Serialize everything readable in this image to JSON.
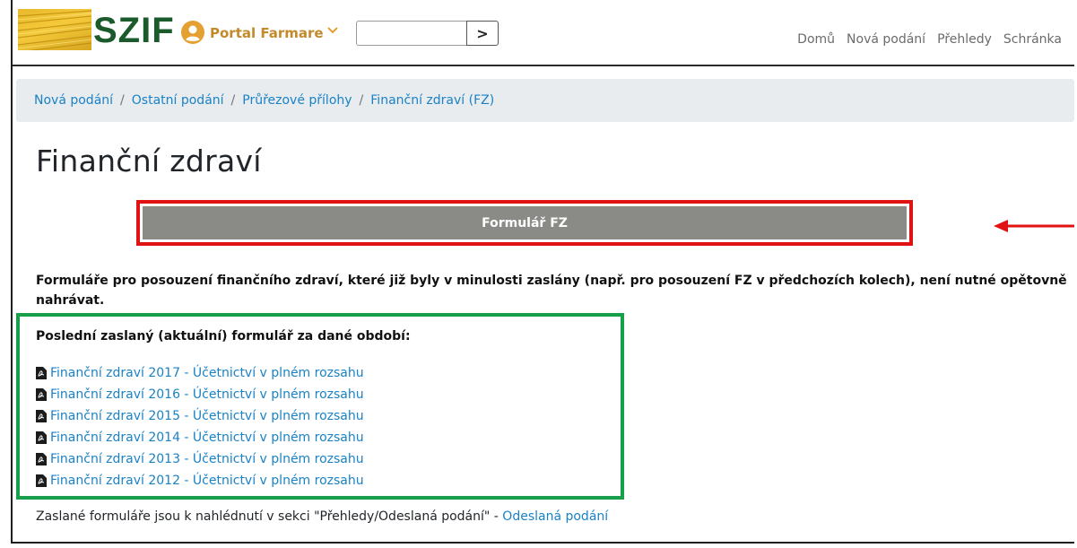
{
  "header": {
    "logo_text": "SZIF",
    "portal_label": "Portal Farmare",
    "search": {
      "value": "",
      "placeholder": ""
    },
    "search_button_symbol": ">",
    "nav": [
      "Domů",
      "Nová podání",
      "Přehledy",
      "Schránka"
    ]
  },
  "breadcrumb": [
    "Nová podání",
    "Ostatní podání",
    "Průřezové přílohy",
    "Finanční zdraví (FZ)"
  ],
  "page": {
    "title": "Finanční zdraví",
    "form_button_label": "Formulář FZ",
    "notice": "Formuláře pro posouzení finančního zdraví, které již byly v minulosti zaslány (např. pro posouzení FZ v předchozích kolech), není nutné opětovně nahrávat.",
    "last_sent_label": "Poslední zaslaný (aktuální) formulář za dané období:",
    "documents": [
      "Finanční zdraví 2017 - Účetnictví v plném rozsahu",
      "Finanční zdraví 2016 - Účetnictví v plném rozsahu",
      "Finanční zdraví 2015 - Účetnictví v plném rozsahu",
      "Finanční zdraví 2014 - Účetnictví v plném rozsahu",
      "Finanční zdraví 2013 - Účetnictví v plném rozsahu",
      "Finanční zdraví 2012 - Účetnictví v plném rozsahu"
    ],
    "footer_text": "Zaslané formuláře jsou k nahlédnutí v sekci \"Přehledy/Odeslaná podání\" - ",
    "footer_link": "Odeslaná podání"
  },
  "icons": {
    "user": "user-circle-icon",
    "chevron": "chevron-down-icon",
    "pdf": "pdf-file-icon",
    "arrow": "arrow-left-icon"
  },
  "colors": {
    "brand_green": "#1b5a2a",
    "portal_orange": "#e4a131",
    "link_blue": "#1a82c5",
    "button_gray": "#8a8a86",
    "highlight_red": "#e11212",
    "highlight_green": "#16a04a"
  }
}
